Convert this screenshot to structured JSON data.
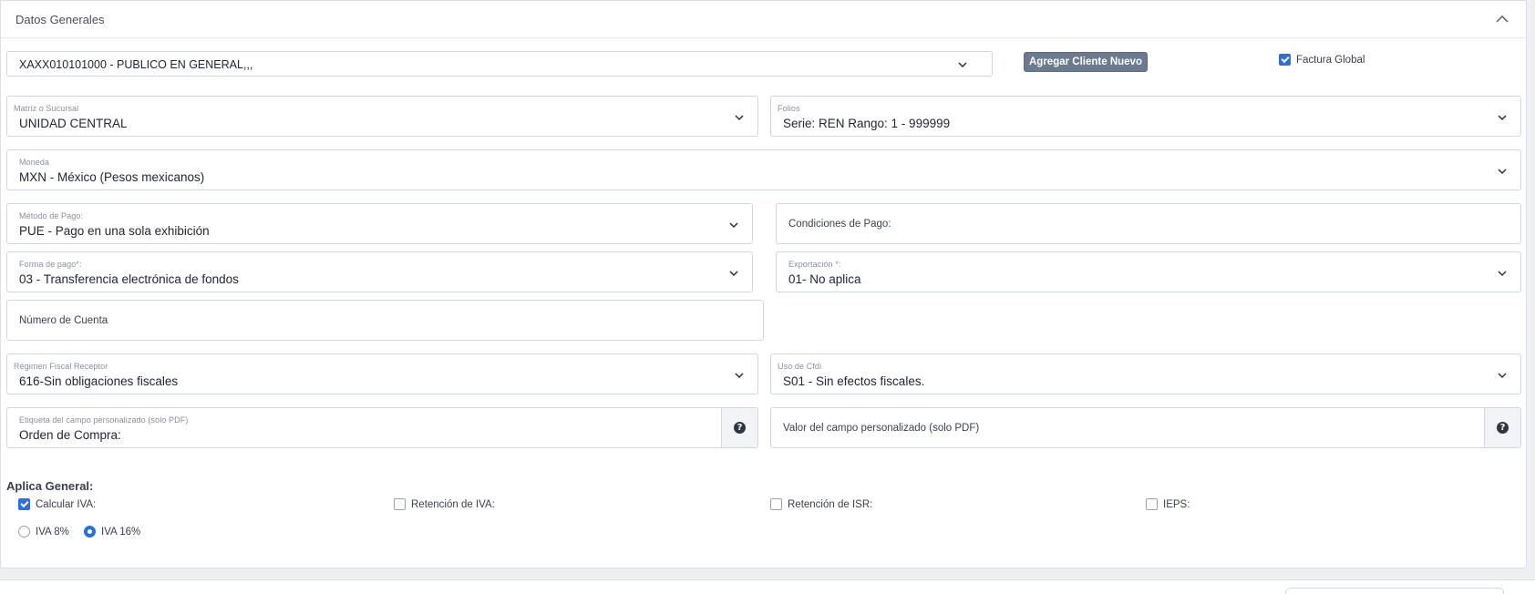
{
  "panel": {
    "title": "Datos Generales"
  },
  "client": {
    "selected": "XAXX010101000 - PUBLICO EN GENERAL,,,",
    "add_button": "Agregar Cliente Nuevo",
    "global_invoice_label": "Factura Global",
    "global_invoice_checked": true
  },
  "branch": {
    "label": "Matriz o Sucursal",
    "value": "UNIDAD CENTRAL"
  },
  "folios": {
    "label": "Folios",
    "value": "Serie: REN Rango: 1 - 999999"
  },
  "currency": {
    "label": "Moneda",
    "value": "MXN - México (Pesos mexicanos)"
  },
  "payment_method": {
    "label": "Método de Pago:",
    "value": "PUE - Pago en una sola exhibición"
  },
  "payment_conditions": {
    "placeholder": "Condiciones de Pago:"
  },
  "payment_form": {
    "label": "Forma de pago*:",
    "value": "03 - Transferencia electrónica de fondos"
  },
  "export": {
    "label": "Exportación *:",
    "value": "01- No aplica"
  },
  "account_number": {
    "placeholder": "Número de Cuenta"
  },
  "tax_regime": {
    "label": "Régimen Fiscal Receptor",
    "value": "616-Sin obligaciones fiscales"
  },
  "cfdi_use": {
    "label": "Uso de Cfdi",
    "value": "S01 - Sin efectos fiscales."
  },
  "custom_field_label": {
    "label": "Etiqueta del campo personalizado (solo PDF)",
    "value": "Orden de Compra:"
  },
  "custom_field_value": {
    "placeholder": "Valor del campo personalizado (solo PDF)"
  },
  "taxes": {
    "title": "Aplica General:",
    "calc_iva": {
      "label": "Calcular IVA:",
      "checked": true
    },
    "ret_iva": {
      "label": "Retención de IVA:",
      "checked": false
    },
    "ret_isr": {
      "label": "Retención de ISR:",
      "checked": false
    },
    "ieps": {
      "label": "IEPS:",
      "checked": false
    },
    "iva_8": {
      "label": "IVA 8%",
      "selected": false
    },
    "iva_16": {
      "label": "IVA 16%",
      "selected": true
    }
  },
  "colors": {
    "accent": "#2c6fd8",
    "button": "#6b7a8f",
    "border": "#cfd6e4"
  },
  "icons": {
    "dropdown": "chevron-down-icon",
    "collapse": "chevron-up-icon",
    "help": "question-circle-icon"
  }
}
